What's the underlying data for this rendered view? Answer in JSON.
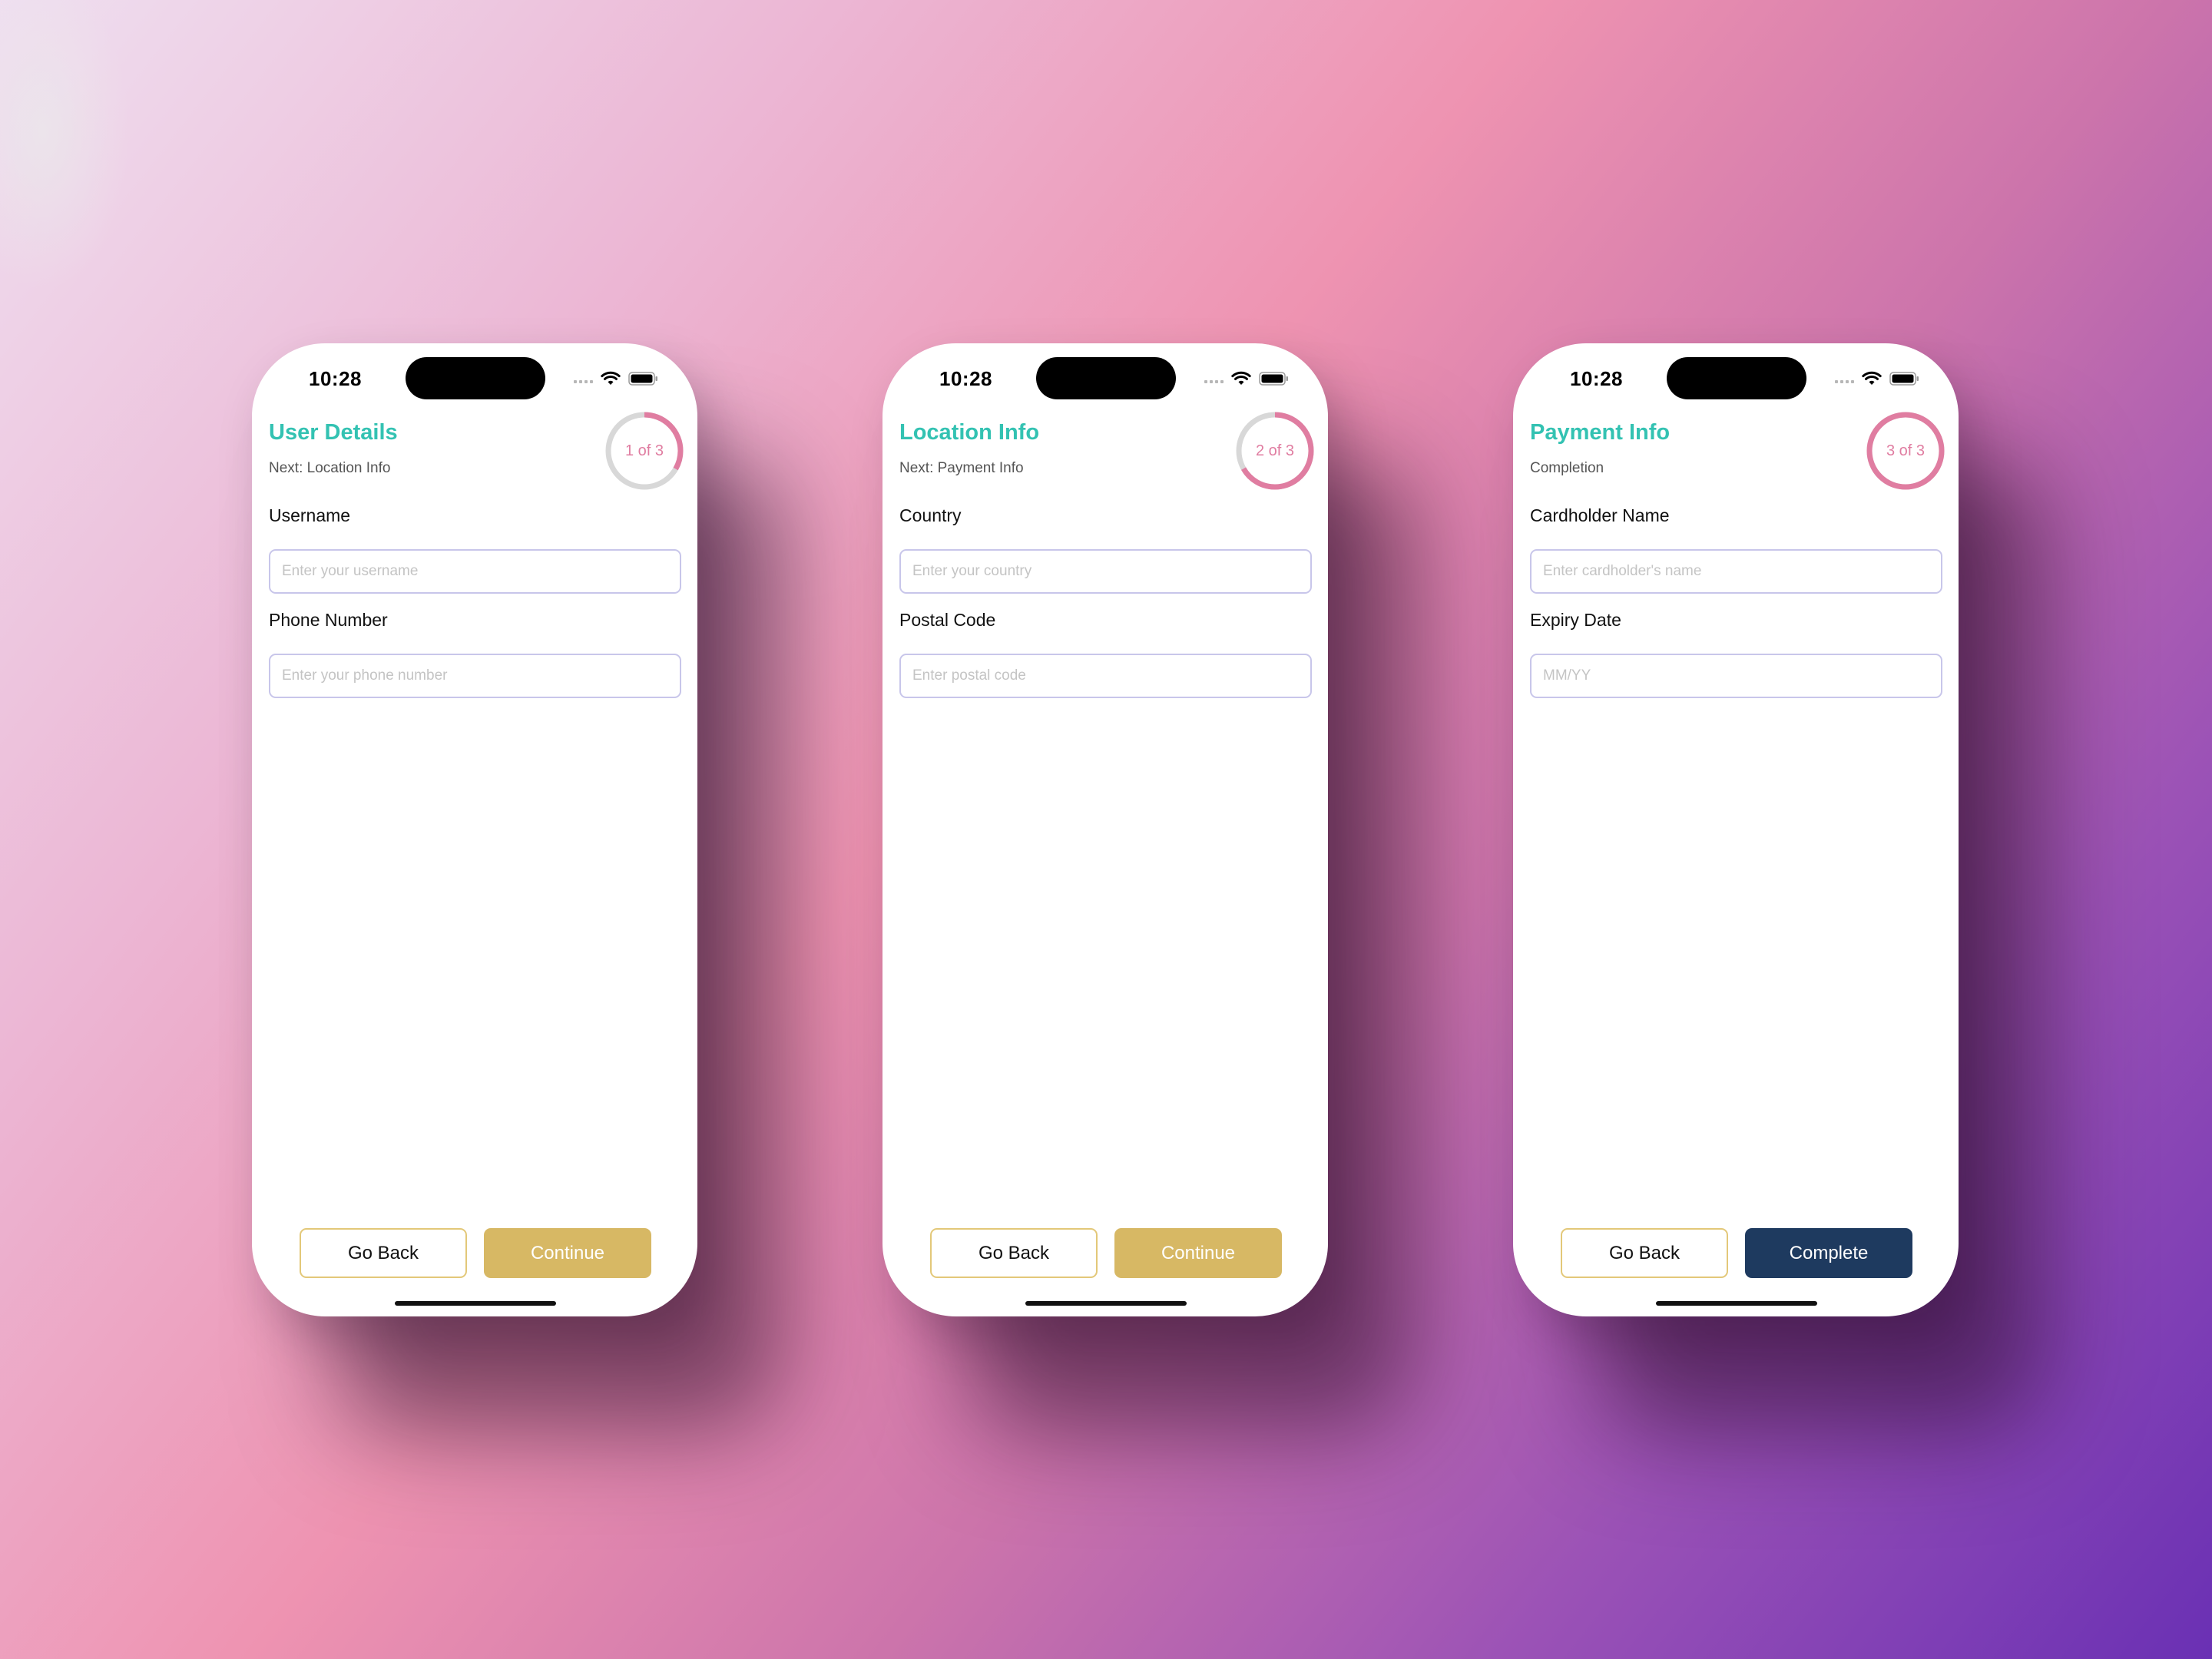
{
  "screens": [
    {
      "status": {
        "time": "10:28"
      },
      "header": {
        "title": "User Details",
        "subtitle": "Next: Location Info"
      },
      "progress": {
        "label": "1 of 3",
        "fraction": 0.333
      },
      "fields": [
        {
          "label": "Username",
          "placeholder": "Enter your username"
        },
        {
          "label": "Phone Number",
          "placeholder": "Enter your phone number"
        }
      ],
      "buttons": {
        "back": "Go Back",
        "primary": "Continue"
      }
    },
    {
      "status": {
        "time": "10:28"
      },
      "header": {
        "title": "Location Info",
        "subtitle": "Next: Payment Info"
      },
      "progress": {
        "label": "2 of 3",
        "fraction": 0.667
      },
      "fields": [
        {
          "label": "Country",
          "placeholder": "Enter your country"
        },
        {
          "label": "Postal Code",
          "placeholder": "Enter postal code"
        }
      ],
      "buttons": {
        "back": "Go Back",
        "primary": "Continue"
      }
    },
    {
      "status": {
        "time": "10:28"
      },
      "header": {
        "title": "Payment Info",
        "subtitle": "Completion"
      },
      "progress": {
        "label": "3 of 3",
        "fraction": 1.0
      },
      "fields": [
        {
          "label": "Cardholder Name",
          "placeholder": "Enter cardholder's name"
        },
        {
          "label": "Expiry Date",
          "placeholder": "MM/YY"
        }
      ],
      "buttons": {
        "back": "Go Back",
        "primary": "Complete"
      }
    }
  ],
  "colors": {
    "title": "#33c2b2",
    "progress_fill": "#e07da1",
    "progress_track": "#d8d8d8",
    "continue_button": "#d7b864",
    "complete_button": "#1e3a5f",
    "back_border": "#e3c879",
    "input_border": "#c8c6ea"
  }
}
